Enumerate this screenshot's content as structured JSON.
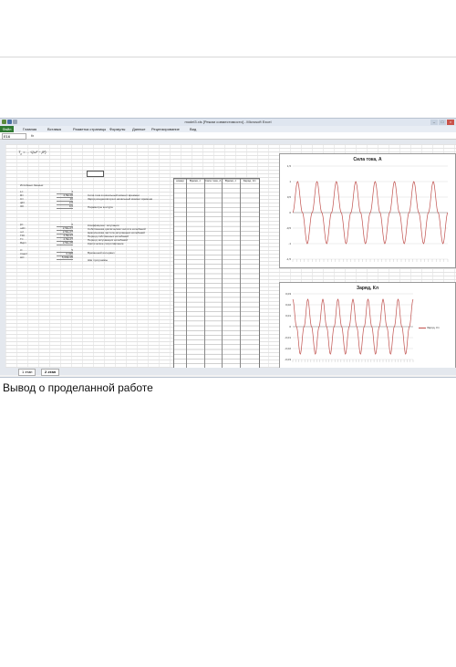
{
  "window": {
    "title": "model3.xls [Режим совместимости] - Microsoft Excel"
  },
  "ribbon": {
    "file_tab": "Файл",
    "tabs": [
      "Главная",
      "Вставка",
      "Разметка страницы",
      "Формулы",
      "Данные",
      "Рецензирование",
      "Вид"
    ]
  },
  "formula_bar": {
    "name_box": "E16",
    "fx_label": "fx"
  },
  "sheet": {
    "initial_data_title": "Исходные данные",
    "params": [
      {
        "name": "L=",
        "value": "4"
      },
      {
        "name": "R=",
        "value": "2,5E-06"
      },
      {
        "name": "C=",
        "value": "20"
      },
      {
        "name": "q0=",
        "value": "2,5"
      },
      {
        "name": "I0=",
        "value": "0,0"
      }
    ],
    "params2": [
      {
        "name": "β=",
        "value": "0"
      },
      {
        "name": "ω0=",
        "value": "2,5E+07"
      },
      {
        "name": "ω=",
        "value": "2,5E+07"
      },
      {
        "name": "T0=",
        "value": "2,5E-07"
      },
      {
        "name": "T=",
        "value": "2,5E-07"
      },
      {
        "name": "Rкр=",
        "value": "2,5E+05"
      }
    ],
    "params3": [
      {
        "name": "t=",
        "value": "5"
      },
      {
        "name": "tmax=",
        "value": "0,025"
      },
      {
        "name": "Δt=",
        "value": "5,00E-05"
      }
    ],
    "descriptions": [
      "Сила тока в начальный момент времени",
      "Заряд конденсатора в начальный момент времени",
      "Параметры контура",
      "Коэффициент затухания",
      "Собственная циклическая частота колебаний",
      "Циклическая частота затухающих колебаний",
      "Период собственных колебаний",
      "Период затухающих колебаний",
      "Критическое сопротивление",
      "Временной интервал",
      "Шаг программы"
    ],
    "table_headers": [
      "номер",
      "Время, с",
      "Сила тока, А",
      "Время, с",
      "Заряд, Кл"
    ]
  },
  "charts": {
    "current": {
      "title": "Сила тока, А"
    },
    "charge": {
      "title": "Заряд, Кл",
      "legend": "Заряд, Кл"
    }
  },
  "chart_data": [
    {
      "type": "line",
      "title": "Сила тока, А",
      "ylim": [
        -1.5,
        1.5
      ],
      "yticks": [
        "1,5",
        "1",
        "0,5",
        "0",
        "-0,5",
        "-1",
        "-1,5"
      ],
      "series": [
        {
          "values": [
            0,
            1,
            0,
            -1,
            0,
            1,
            0,
            -1,
            0,
            1,
            0,
            -1,
            0,
            1,
            0,
            -1,
            0,
            1,
            0,
            -1,
            0,
            1,
            0,
            -1,
            0,
            1,
            0,
            -1,
            0,
            1,
            0,
            -1,
            0
          ]
        }
      ],
      "color": "#c0504d"
    },
    {
      "type": "line",
      "title": "Заряд, Кл",
      "ylim": [
        -0.03,
        0.03
      ],
      "yticks": [
        "0,03",
        "0,02",
        "0,01",
        "0",
        "-0,01",
        "-0,02",
        "-0,03"
      ],
      "series": [
        {
          "name": "Заряд, Кл",
          "values": [
            0.025,
            0,
            -0.025,
            0,
            0.025,
            0,
            -0.025,
            0,
            0.025,
            0,
            -0.025,
            0,
            0.025,
            0,
            -0.025,
            0,
            0.025,
            0,
            -0.025,
            0,
            0.025,
            0,
            -0.025,
            0,
            0.025,
            0,
            -0.025,
            0,
            0.025,
            0,
            -0.025,
            0,
            0.025
          ]
        }
      ],
      "color": "#c0504d"
    }
  ],
  "sheet_tabs": [
    "1 этап",
    "2 этап"
  ],
  "caption": "Вывод о проделанной работе"
}
